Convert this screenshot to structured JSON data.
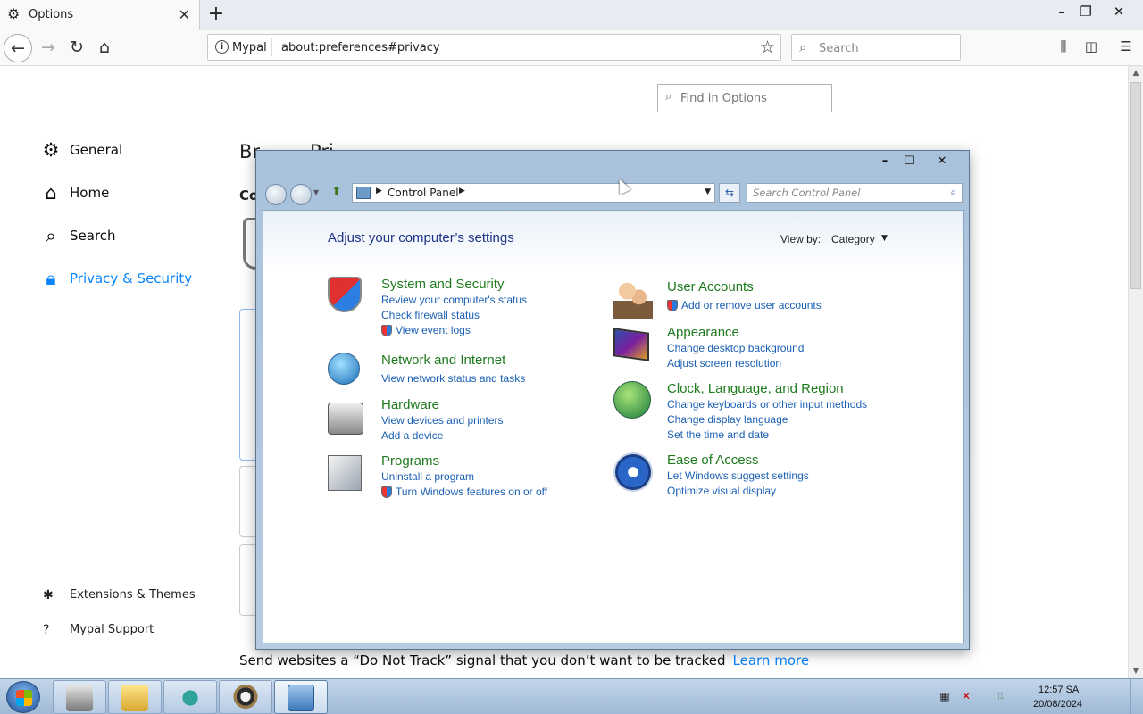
{
  "browser": {
    "tab": {
      "title": "Options",
      "icon": "gear-icon"
    },
    "new_tab_label": "+",
    "window_controls": {
      "minimize": "–",
      "restore": "❐",
      "close": "✕"
    },
    "identity_label": "Mypal",
    "url": "about:preferences#privacy",
    "search_placeholder": "Search"
  },
  "preferences": {
    "find_placeholder": "Find in Options",
    "categories": [
      {
        "label": "General",
        "icon": "gear-icon",
        "selected": false
      },
      {
        "label": "Home",
        "icon": "home-icon",
        "selected": false
      },
      {
        "label": "Search",
        "icon": "search-icon",
        "selected": false
      },
      {
        "label": "Privacy & Security",
        "icon": "lock-icon",
        "selected": true
      }
    ],
    "footer_links": [
      {
        "label": "Extensions & Themes",
        "icon": "puzzle-icon"
      },
      {
        "label": "Mypal Support",
        "icon": "help-icon"
      }
    ],
    "heading_partial": "Br",
    "heading_partial_2": "Pri",
    "subheading_partial": "Co",
    "dnt_text": "Send websites a “Do Not Track” signal that you don’t want to be tracked",
    "dnt_link": "Learn more"
  },
  "control_panel": {
    "window_controls": {
      "minimize": "–",
      "maximize": "☐",
      "close": "✕"
    },
    "breadcrumb": "Control Panel",
    "search_placeholder": "Search Control Panel",
    "heading": "Adjust your computer’s settings",
    "view_by_label": "View by:",
    "view_by_value": "Category",
    "categories": [
      {
        "title": "System and Security",
        "links": [
          "Review your computer's status",
          "Check firewall status",
          "View event logs"
        ],
        "shield_links": [
          false,
          false,
          true
        ]
      },
      {
        "title": "Network and Internet",
        "links": [
          "View network status and tasks"
        ],
        "shield_links": [
          false
        ]
      },
      {
        "title": "Hardware",
        "links": [
          "View devices and printers",
          "Add a device"
        ],
        "shield_links": [
          false,
          false
        ]
      },
      {
        "title": "Programs",
        "links": [
          "Uninstall a program",
          "Turn Windows features on or off"
        ],
        "shield_links": [
          false,
          true
        ]
      },
      {
        "title": "User Accounts",
        "links": [
          "Add or remove user accounts"
        ],
        "shield_links": [
          true
        ]
      },
      {
        "title": "Appearance",
        "links": [
          "Change desktop background",
          "Adjust screen resolution"
        ],
        "shield_links": [
          false,
          false
        ]
      },
      {
        "title": "Clock, Language, and Region",
        "links": [
          "Change keyboards or other input methods",
          "Change display language",
          "Set the time and date"
        ],
        "shield_links": [
          false,
          false,
          false
        ]
      },
      {
        "title": "Ease of Access",
        "links": [
          "Let Windows suggest settings",
          "Optimize visual display"
        ],
        "shield_links": [
          false,
          false
        ]
      }
    ]
  },
  "taskbar": {
    "apps": [
      "server-manager",
      "file-explorer",
      "snake-app",
      "raccoon-browser",
      "control-panel"
    ],
    "clock_time": "12:57 SA",
    "clock_date": "20/08/2024"
  }
}
